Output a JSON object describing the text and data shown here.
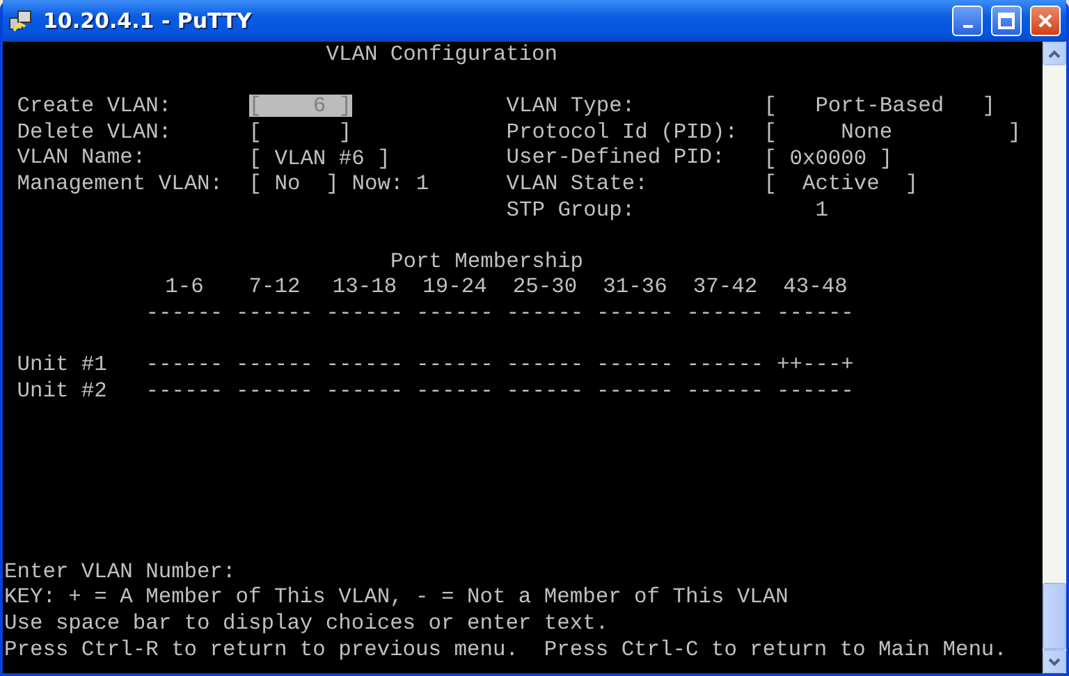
{
  "window": {
    "title": "10.20.4.1 - PuTTY"
  },
  "screen": {
    "title": "VLAN Configuration",
    "left_fields": [
      {
        "label": "Create VLAN:",
        "value": "[    6 ]",
        "focused": true
      },
      {
        "label": "Delete VLAN:",
        "value": "[      ]",
        "focused": false
      },
      {
        "label": "VLAN Name:",
        "value": "[ VLAN #6 ]",
        "focused": false
      },
      {
        "label": "Management VLAN:",
        "value": "[ No  ]",
        "focused": false,
        "note": "Now: 1"
      }
    ],
    "right_fields": [
      {
        "label": "VLAN Type:",
        "value": "[   Port-Based   ]",
        "focused": false
      },
      {
        "label": "Protocol Id (PID):",
        "value": "[     None         ]",
        "focused": false
      },
      {
        "label": "User-Defined PID:",
        "value": "[ 0x0000 ]",
        "focused": false
      },
      {
        "label": "VLAN State:",
        "value": "[  Active  ]",
        "focused": false
      },
      {
        "label": "STP Group:",
        "value": "1",
        "focused": false
      }
    ],
    "membership": {
      "title": "Port Membership",
      "columns": [
        "1-6",
        "7-12",
        "13-18",
        "19-24",
        "25-30",
        "31-36",
        "37-42",
        "43-48"
      ],
      "rules": [
        "------",
        "------",
        "------",
        "------",
        "------",
        "------",
        "------",
        "------"
      ],
      "units": [
        {
          "name": "Unit #1",
          "ports": [
            "------",
            "------",
            "------",
            "------",
            "------",
            "------",
            "------",
            "++---+"
          ]
        },
        {
          "name": "Unit #2",
          "ports": [
            "------",
            "------",
            "------",
            "------",
            "------",
            "------",
            "------",
            "------"
          ]
        }
      ]
    },
    "prompt": "Enter VLAN Number:",
    "help_lines": [
      "KEY: + = A Member of This VLAN, - = Not a Member of This VLAN",
      "Use space bar to display choices or enter text.",
      "Press Ctrl-R to return to previous menu.  Press Ctrl-C to return to Main Menu."
    ]
  }
}
